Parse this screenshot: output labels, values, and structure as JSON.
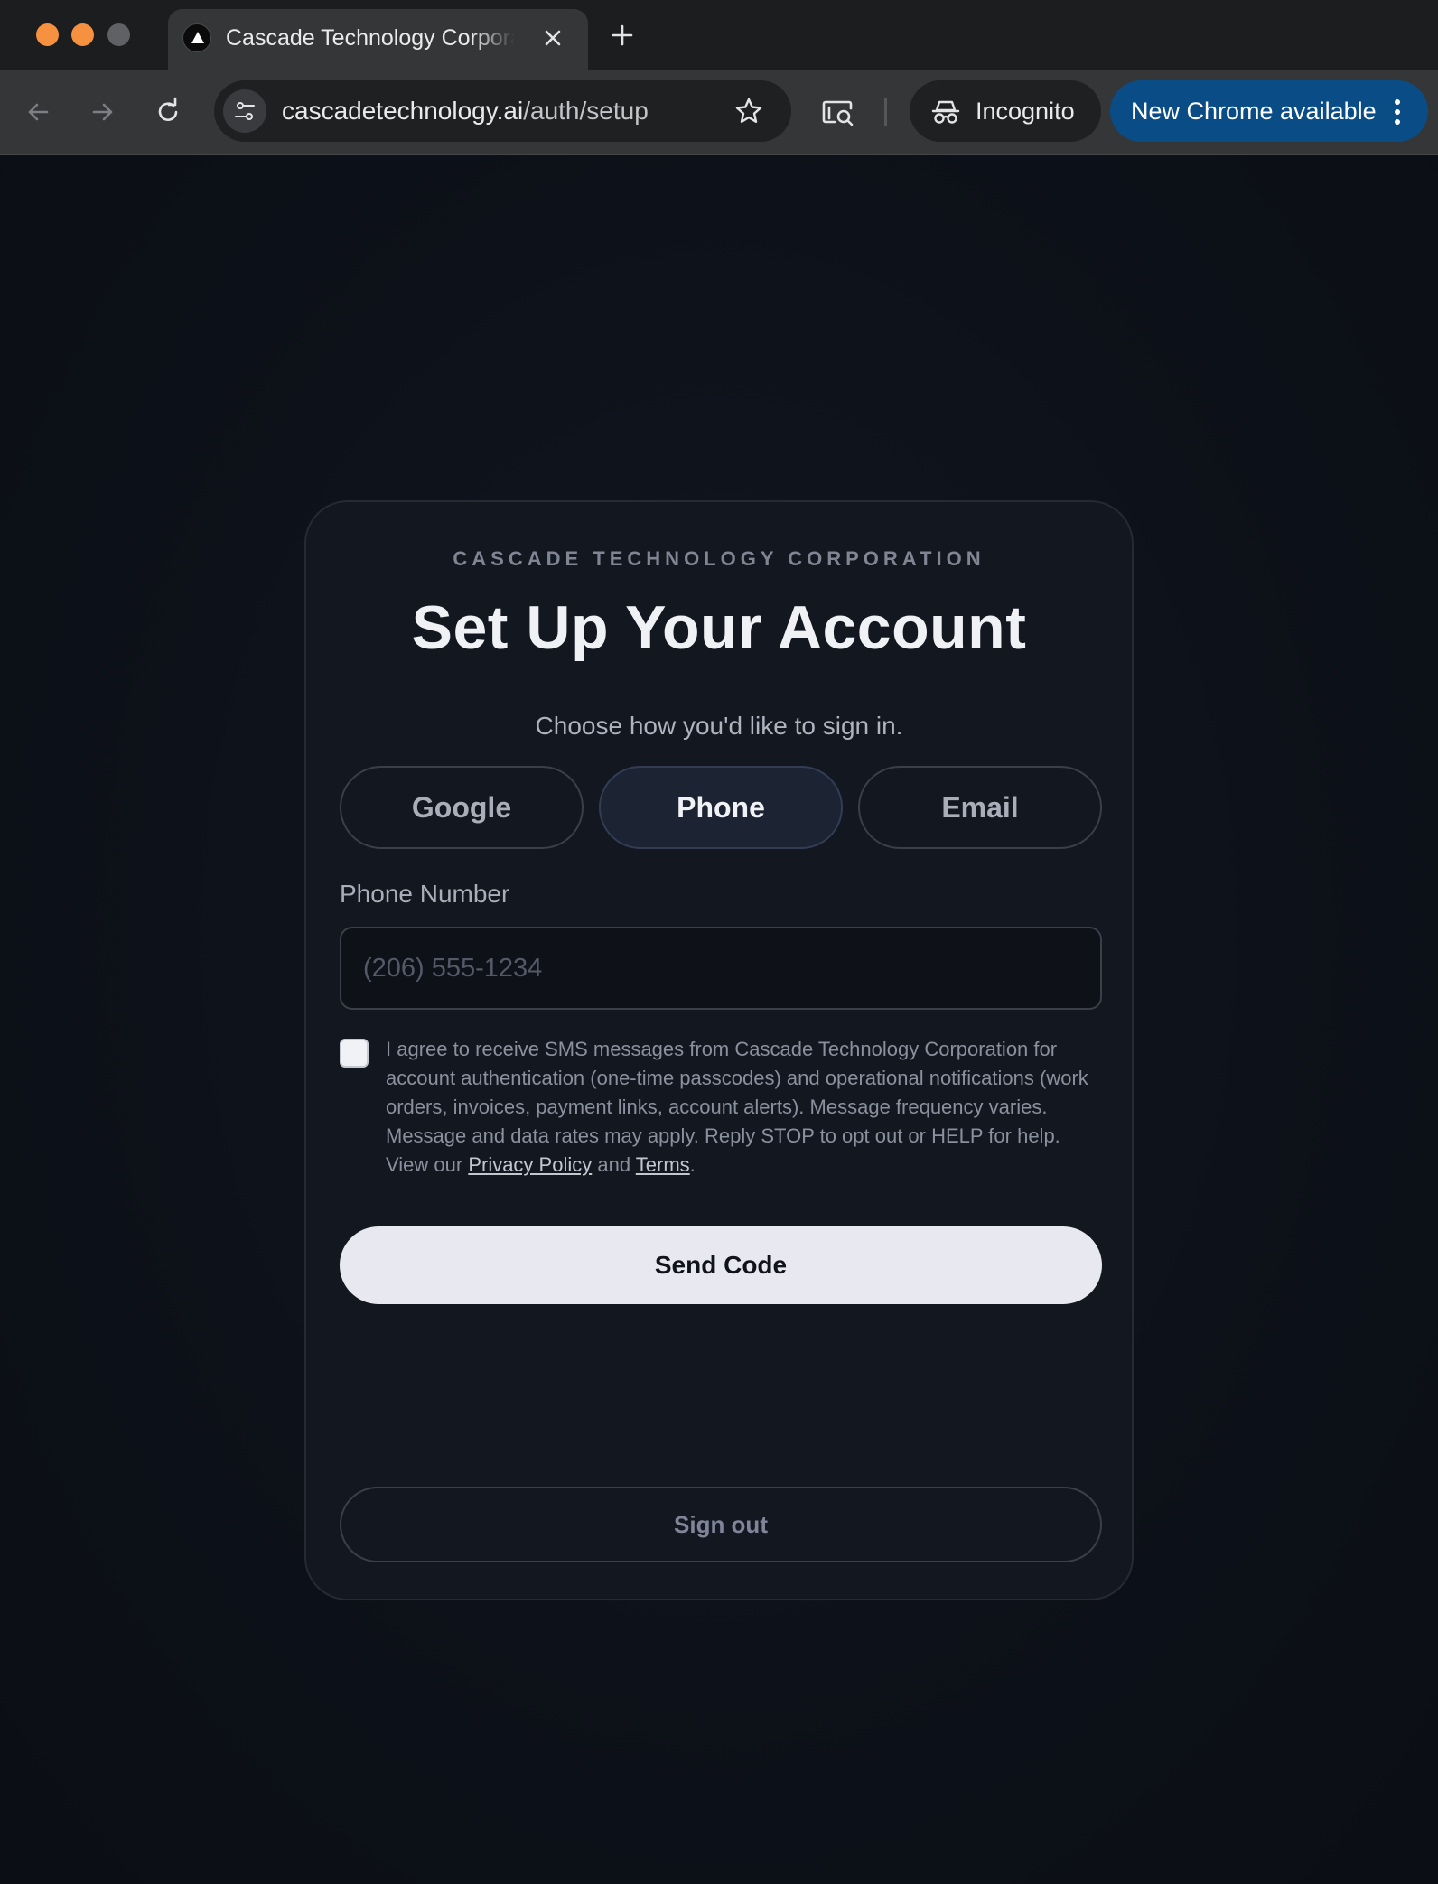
{
  "browser": {
    "tab_title": "Cascade Technology Corporation",
    "url_domain": "cascadetechnology.ai",
    "url_path": "/auth/setup",
    "incognito_label": "Incognito",
    "update_label": "New Chrome available",
    "colors": {
      "traffic_active": "#f6913f",
      "update_pill": "#0a4c86"
    }
  },
  "card": {
    "eyebrow": "CASCADE TECHNOLOGY CORPORATION",
    "title": "Set Up Your Account",
    "subtitle": "Choose how you'd like to sign in.",
    "methods": [
      {
        "label": "Google",
        "selected": false
      },
      {
        "label": "Phone",
        "selected": true
      },
      {
        "label": "Email",
        "selected": false
      }
    ],
    "phone_label": "Phone Number",
    "phone_placeholder": "(206) 555-1234",
    "phone_value": "",
    "consent": {
      "checked": false,
      "text_before": "I agree to receive SMS messages from Cascade Technology Corporation for account authentication (one-time passcodes) and operational notifications (work orders, invoices, payment links, account alerts). Message frequency varies. Message and data rates may apply. Reply STOP to opt out or HELP for help. View our ",
      "privacy_link": "Privacy Policy",
      "and_text": " and ",
      "terms_link": "Terms",
      "period": "."
    },
    "send_button": "Send Code",
    "signout_button": "Sign out"
  }
}
